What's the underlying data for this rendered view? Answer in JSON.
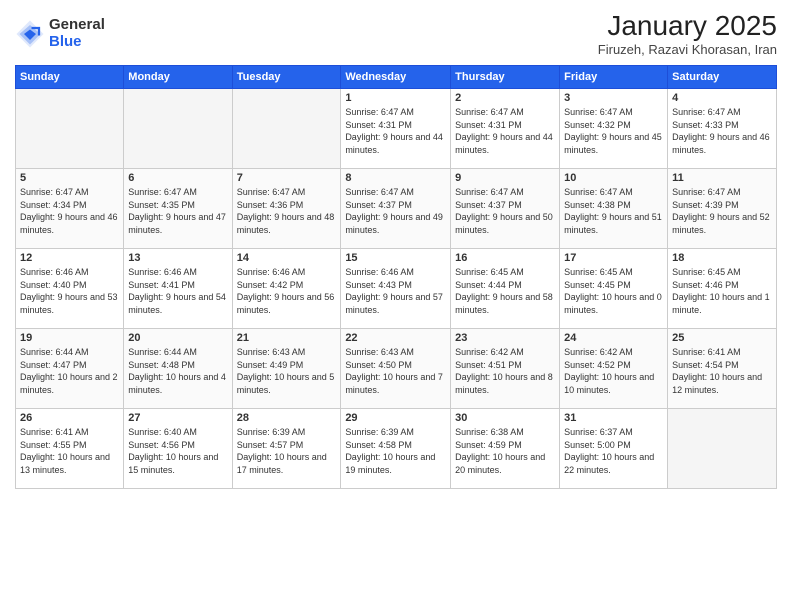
{
  "header": {
    "logo_general": "General",
    "logo_blue": "Blue",
    "month_title": "January 2025",
    "location": "Firuzeh, Razavi Khorasan, Iran"
  },
  "weekdays": [
    "Sunday",
    "Monday",
    "Tuesday",
    "Wednesday",
    "Thursday",
    "Friday",
    "Saturday"
  ],
  "weeks": [
    [
      {
        "day": "",
        "sunrise": "",
        "sunset": "",
        "daylight": ""
      },
      {
        "day": "",
        "sunrise": "",
        "sunset": "",
        "daylight": ""
      },
      {
        "day": "",
        "sunrise": "",
        "sunset": "",
        "daylight": ""
      },
      {
        "day": "1",
        "sunrise": "Sunrise: 6:47 AM",
        "sunset": "Sunset: 4:31 PM",
        "daylight": "Daylight: 9 hours and 44 minutes."
      },
      {
        "day": "2",
        "sunrise": "Sunrise: 6:47 AM",
        "sunset": "Sunset: 4:31 PM",
        "daylight": "Daylight: 9 hours and 44 minutes."
      },
      {
        "day": "3",
        "sunrise": "Sunrise: 6:47 AM",
        "sunset": "Sunset: 4:32 PM",
        "daylight": "Daylight: 9 hours and 45 minutes."
      },
      {
        "day": "4",
        "sunrise": "Sunrise: 6:47 AM",
        "sunset": "Sunset: 4:33 PM",
        "daylight": "Daylight: 9 hours and 46 minutes."
      }
    ],
    [
      {
        "day": "5",
        "sunrise": "Sunrise: 6:47 AM",
        "sunset": "Sunset: 4:34 PM",
        "daylight": "Daylight: 9 hours and 46 minutes."
      },
      {
        "day": "6",
        "sunrise": "Sunrise: 6:47 AM",
        "sunset": "Sunset: 4:35 PM",
        "daylight": "Daylight: 9 hours and 47 minutes."
      },
      {
        "day": "7",
        "sunrise": "Sunrise: 6:47 AM",
        "sunset": "Sunset: 4:36 PM",
        "daylight": "Daylight: 9 hours and 48 minutes."
      },
      {
        "day": "8",
        "sunrise": "Sunrise: 6:47 AM",
        "sunset": "Sunset: 4:37 PM",
        "daylight": "Daylight: 9 hours and 49 minutes."
      },
      {
        "day": "9",
        "sunrise": "Sunrise: 6:47 AM",
        "sunset": "Sunset: 4:37 PM",
        "daylight": "Daylight: 9 hours and 50 minutes."
      },
      {
        "day": "10",
        "sunrise": "Sunrise: 6:47 AM",
        "sunset": "Sunset: 4:38 PM",
        "daylight": "Daylight: 9 hours and 51 minutes."
      },
      {
        "day": "11",
        "sunrise": "Sunrise: 6:47 AM",
        "sunset": "Sunset: 4:39 PM",
        "daylight": "Daylight: 9 hours and 52 minutes."
      }
    ],
    [
      {
        "day": "12",
        "sunrise": "Sunrise: 6:46 AM",
        "sunset": "Sunset: 4:40 PM",
        "daylight": "Daylight: 9 hours and 53 minutes."
      },
      {
        "day": "13",
        "sunrise": "Sunrise: 6:46 AM",
        "sunset": "Sunset: 4:41 PM",
        "daylight": "Daylight: 9 hours and 54 minutes."
      },
      {
        "day": "14",
        "sunrise": "Sunrise: 6:46 AM",
        "sunset": "Sunset: 4:42 PM",
        "daylight": "Daylight: 9 hours and 56 minutes."
      },
      {
        "day": "15",
        "sunrise": "Sunrise: 6:46 AM",
        "sunset": "Sunset: 4:43 PM",
        "daylight": "Daylight: 9 hours and 57 minutes."
      },
      {
        "day": "16",
        "sunrise": "Sunrise: 6:45 AM",
        "sunset": "Sunset: 4:44 PM",
        "daylight": "Daylight: 9 hours and 58 minutes."
      },
      {
        "day": "17",
        "sunrise": "Sunrise: 6:45 AM",
        "sunset": "Sunset: 4:45 PM",
        "daylight": "Daylight: 10 hours and 0 minutes."
      },
      {
        "day": "18",
        "sunrise": "Sunrise: 6:45 AM",
        "sunset": "Sunset: 4:46 PM",
        "daylight": "Daylight: 10 hours and 1 minute."
      }
    ],
    [
      {
        "day": "19",
        "sunrise": "Sunrise: 6:44 AM",
        "sunset": "Sunset: 4:47 PM",
        "daylight": "Daylight: 10 hours and 2 minutes."
      },
      {
        "day": "20",
        "sunrise": "Sunrise: 6:44 AM",
        "sunset": "Sunset: 4:48 PM",
        "daylight": "Daylight: 10 hours and 4 minutes."
      },
      {
        "day": "21",
        "sunrise": "Sunrise: 6:43 AM",
        "sunset": "Sunset: 4:49 PM",
        "daylight": "Daylight: 10 hours and 5 minutes."
      },
      {
        "day": "22",
        "sunrise": "Sunrise: 6:43 AM",
        "sunset": "Sunset: 4:50 PM",
        "daylight": "Daylight: 10 hours and 7 minutes."
      },
      {
        "day": "23",
        "sunrise": "Sunrise: 6:42 AM",
        "sunset": "Sunset: 4:51 PM",
        "daylight": "Daylight: 10 hours and 8 minutes."
      },
      {
        "day": "24",
        "sunrise": "Sunrise: 6:42 AM",
        "sunset": "Sunset: 4:52 PM",
        "daylight": "Daylight: 10 hours and 10 minutes."
      },
      {
        "day": "25",
        "sunrise": "Sunrise: 6:41 AM",
        "sunset": "Sunset: 4:54 PM",
        "daylight": "Daylight: 10 hours and 12 minutes."
      }
    ],
    [
      {
        "day": "26",
        "sunrise": "Sunrise: 6:41 AM",
        "sunset": "Sunset: 4:55 PM",
        "daylight": "Daylight: 10 hours and 13 minutes."
      },
      {
        "day": "27",
        "sunrise": "Sunrise: 6:40 AM",
        "sunset": "Sunset: 4:56 PM",
        "daylight": "Daylight: 10 hours and 15 minutes."
      },
      {
        "day": "28",
        "sunrise": "Sunrise: 6:39 AM",
        "sunset": "Sunset: 4:57 PM",
        "daylight": "Daylight: 10 hours and 17 minutes."
      },
      {
        "day": "29",
        "sunrise": "Sunrise: 6:39 AM",
        "sunset": "Sunset: 4:58 PM",
        "daylight": "Daylight: 10 hours and 19 minutes."
      },
      {
        "day": "30",
        "sunrise": "Sunrise: 6:38 AM",
        "sunset": "Sunset: 4:59 PM",
        "daylight": "Daylight: 10 hours and 20 minutes."
      },
      {
        "day": "31",
        "sunrise": "Sunrise: 6:37 AM",
        "sunset": "Sunset: 5:00 PM",
        "daylight": "Daylight: 10 hours and 22 minutes."
      },
      {
        "day": "",
        "sunrise": "",
        "sunset": "",
        "daylight": ""
      }
    ]
  ]
}
